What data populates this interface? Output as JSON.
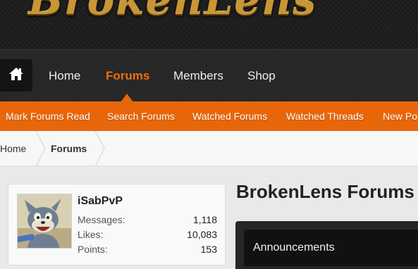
{
  "site": {
    "logo_text": "BrokenLens"
  },
  "nav": {
    "home_icon": "home-icon",
    "items": [
      {
        "label": "Home"
      },
      {
        "label": "Forums"
      },
      {
        "label": "Members"
      },
      {
        "label": "Shop"
      }
    ],
    "active": "Forums"
  },
  "subnav": {
    "items": [
      {
        "label": "Mark Forums Read"
      },
      {
        "label": "Search Forums"
      },
      {
        "label": "Watched Forums"
      },
      {
        "label": "Watched Threads"
      },
      {
        "label": "New Posts"
      }
    ]
  },
  "breadcrumb": {
    "items": [
      {
        "label": "Home"
      },
      {
        "label": "Forums"
      }
    ]
  },
  "user": {
    "name": "iSabPvP",
    "stats": [
      {
        "label": "Messages:",
        "value": "1,118"
      },
      {
        "label": "Likes:",
        "value": "10,083"
      },
      {
        "label": "Points:",
        "value": "153"
      }
    ]
  },
  "main": {
    "title": "BrokenLens Forums",
    "section_title": "Announcements"
  },
  "colors": {
    "accent": "#e8660a",
    "nav_active": "#ef6f0c",
    "nav_bg": "#262626",
    "banner_bg": "#1b1b1b",
    "logo_gold": "#c99636"
  }
}
